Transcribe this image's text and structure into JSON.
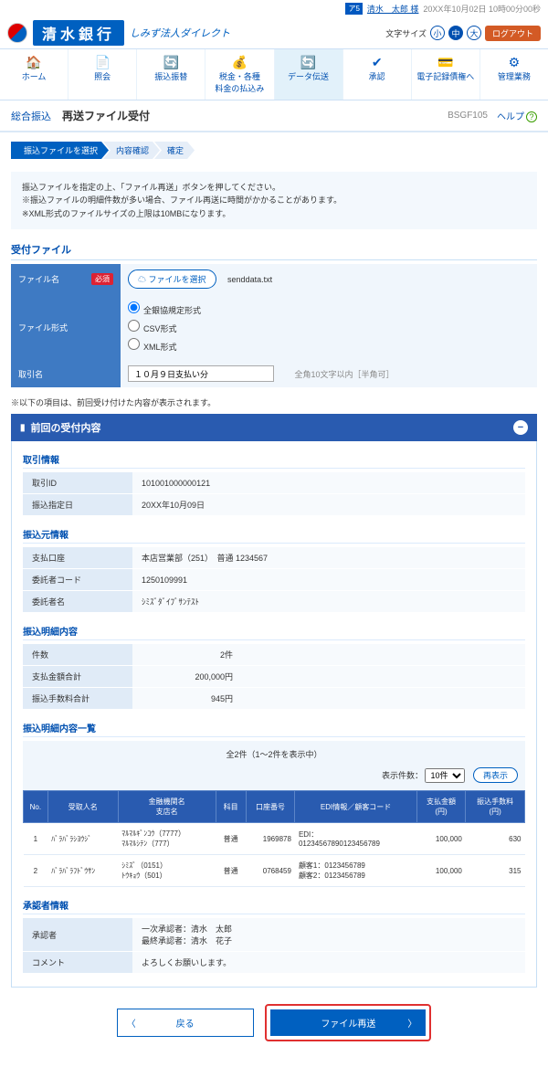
{
  "top": {
    "icon": "ア5",
    "user_link": "清水　太郎 様",
    "timestamp": "20XX年10月02日 10時00分00秒",
    "size_label": "文字サイズ",
    "sizes": [
      "小",
      "中",
      "大"
    ],
    "logout": "ログアウト"
  },
  "brand": {
    "name": "清水銀行",
    "sub": "しみず法人ダイレクト"
  },
  "nav": [
    {
      "icon": "🏠",
      "label": "ホーム"
    },
    {
      "icon": "📄",
      "label": "照会"
    },
    {
      "icon": "🔄",
      "label": "振込振替"
    },
    {
      "icon": "💰",
      "label": "税金・各種\n料金の払込み"
    },
    {
      "icon": "🔄",
      "label": "データ伝送",
      "active": true
    },
    {
      "icon": "✔",
      "label": "承認"
    },
    {
      "icon": "💳",
      "label": "電子記録債権へ"
    },
    {
      "icon": "⚙",
      "label": "管理業務"
    }
  ],
  "title": {
    "cat": "総合振込",
    "main": "再送ファイル受付",
    "code": "BSGF105",
    "help": "ヘルプ"
  },
  "steps": [
    "振込ファイルを選択",
    "内容確認",
    "確定"
  ],
  "notes": [
    "振込ファイルを指定の上、「ファイル再送」ボタンを押してください。",
    "※振込ファイルの明細件数が多い場合、ファイル再送に時間がかかることがあります。",
    "※XML形式のファイルサイズの上限は10MBになります。"
  ],
  "recv": {
    "title": "受付ファイル",
    "rows": {
      "file_label": "ファイル名",
      "req": "必須",
      "file_btn": "ファイルを選択",
      "filename": "senddata.txt",
      "fmt_label": "ファイル形式",
      "fmts": [
        "全銀協規定形式",
        "CSV形式",
        "XML形式"
      ],
      "name_label": "取引名",
      "name_val": "１０月９日支払い分",
      "name_hint": "全角10文字以内［半角可］"
    }
  },
  "note2": "※以下の項目は、前回受け付けた内容が表示されます。",
  "panel_title": "前回の受付内容",
  "txn": {
    "title": "取引情報",
    "id_l": "取引ID",
    "id_v": "101001000000121",
    "date_l": "振込指定日",
    "date_v": "20XX年10月09日"
  },
  "src": {
    "title": "振込元情報",
    "acct_l": "支払口座",
    "acct_v": "本店営業部（251）　普通 1234567",
    "code_l": "委託者コード",
    "code_v": "1250109991",
    "name_l": "委託者名",
    "name_v": "ｼﾐｽﾞﾀﾞｲﾌﾞｻﾝﾃｽﾄ"
  },
  "sum": {
    "title": "振込明細内容",
    "cnt_l": "件数",
    "cnt_v": "2件",
    "amt_l": "支払金額合計",
    "amt_v": "200,000円",
    "fee_l": "振込手数料合計",
    "fee_v": "945円"
  },
  "list": {
    "title": "振込明細内容一覧",
    "cap": "全2件（1～2件を表示中）",
    "disp_l": "表示件数：",
    "disp_v": "10件",
    "redisp": "再表示",
    "head": [
      "No.",
      "受取人名",
      "金融機関名\n支店名",
      "科目",
      "口座番号",
      "EDI情報／顧客コード",
      "支払金額\n(円)",
      "振込手数料\n(円)"
    ],
    "rows": [
      {
        "no": "1",
        "payee": "ﾊﾞﾗﾊﾞﾗｼﾖｳｼﾞ",
        "bank": "ﾏﾙﾏﾙｷﾞﾝｺｳ（7777）\nﾏﾙﾏﾙｼﾃﾝ（777）",
        "type": "普通",
        "acct": "1969878",
        "edi": "EDI：\n0123456789012345​6789",
        "amt": "100,000",
        "fee": "630"
      },
      {
        "no": "2",
        "payee": "ﾊﾞﾗﾊﾞﾗﾌﾄﾞｳｻﾝ",
        "bank": "ｼﾐｽﾞ（0151）\nﾄｳｷｮｳ（501）",
        "type": "普通",
        "acct": "0768459",
        "edi": "顧客1：0123456789\n顧客2：0123456789",
        "amt": "100,000",
        "fee": "315"
      }
    ]
  },
  "appr": {
    "title": "承認者情報",
    "apv_l": "承認者",
    "apv_v": "一次承認者：清水　太郎\n最終承認者：清水　花子",
    "cmt_l": "コメント",
    "cmt_v": "よろしくお願いします。"
  },
  "actions": {
    "back": "戻る",
    "main": "ファイル再送"
  }
}
